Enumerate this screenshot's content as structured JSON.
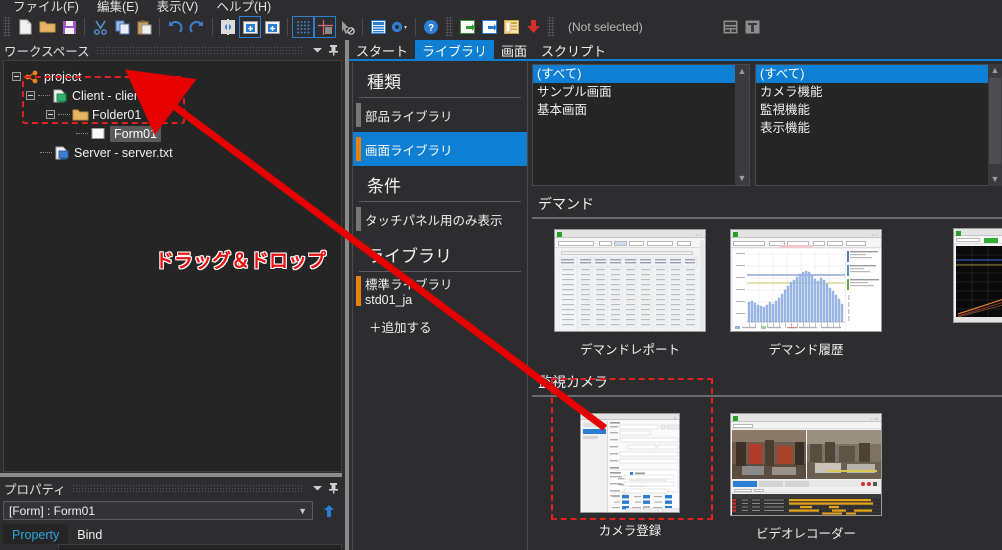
{
  "menu": {
    "items": [
      {
        "label": "ファイル(F)",
        "name": "menu-file"
      },
      {
        "label": "編集(E)",
        "name": "menu-edit"
      },
      {
        "label": "表示(V)",
        "name": "menu-view"
      },
      {
        "label": "ヘルプ(H)",
        "name": "menu-help"
      }
    ]
  },
  "toolbar": {
    "status_text": "(Not selected)",
    "buttons": [
      {
        "name": "new-file-icon",
        "tip": "新規"
      },
      {
        "name": "open-folder-icon",
        "tip": "開く"
      },
      {
        "name": "save-icon",
        "tip": "保存"
      },
      {
        "name": "cut-icon",
        "tip": "切り取り"
      },
      {
        "name": "copy-icon",
        "tip": "コピー"
      },
      {
        "name": "paste-icon",
        "tip": "貼り付け"
      },
      {
        "name": "undo-icon",
        "tip": "元に戻す"
      },
      {
        "name": "redo-icon",
        "tip": "やり直し"
      },
      {
        "name": "settings-gear-icon",
        "tip": "設定"
      },
      {
        "name": "add-window-icon",
        "tip": "追加"
      },
      {
        "name": "add-window-2-icon",
        "tip": "追加2"
      },
      {
        "name": "grid-dots-icon",
        "tip": "グリッド"
      },
      {
        "name": "align-crosshair-icon",
        "tip": "整列"
      },
      {
        "name": "select-disabled-icon",
        "tip": "選択不可"
      },
      {
        "name": "properties-window-icon",
        "tip": "プロパティ"
      },
      {
        "name": "gear-dropdown-icon",
        "tip": "オプション"
      },
      {
        "name": "help-icon",
        "tip": "ヘルプ"
      },
      {
        "name": "run-green-icon",
        "tip": "実行"
      },
      {
        "name": "run-blue-icon",
        "tip": "実行2"
      },
      {
        "name": "table-icon",
        "tip": "テーブル"
      },
      {
        "name": "download-red-icon",
        "tip": "ダウンロード"
      },
      {
        "name": "layout-icon",
        "tip": "レイアウト"
      },
      {
        "name": "text-tool-icon",
        "tip": "テキスト"
      }
    ]
  },
  "workspace": {
    "title": "ワークスペース",
    "tree": [
      {
        "label": "project",
        "icon": "project-icon",
        "depth": 0,
        "expander": "minus"
      },
      {
        "label": "Client - client.xml",
        "icon": "client-file-icon",
        "depth": 1,
        "expander": "minus"
      },
      {
        "label": "Folder01",
        "icon": "folder-icon",
        "depth": 2,
        "expander": "minus"
      },
      {
        "label": "Form01",
        "icon": "form-icon",
        "depth": 3,
        "expander": "none",
        "selected": true
      },
      {
        "label": "Server - server.txt",
        "icon": "server-file-icon",
        "depth": 1,
        "expander": "none"
      }
    ],
    "drag_label": "ドラッグ＆ドロップ"
  },
  "property": {
    "title": "プロパティ",
    "selected_object": "[Form] : Form01",
    "tabs": [
      {
        "label": "Property",
        "active": true
      },
      {
        "label": "Bind",
        "active": false
      }
    ]
  },
  "tabs": [
    {
      "label": "スタート",
      "active": false,
      "name": "tab-start"
    },
    {
      "label": "ライブラリ",
      "active": true,
      "name": "tab-library"
    },
    {
      "label": "画面",
      "active": false,
      "name": "tab-screen"
    },
    {
      "label": "スクリプト",
      "active": false,
      "name": "tab-script"
    }
  ],
  "category_panel": {
    "sections": [
      {
        "heading": "種類",
        "items": [
          {
            "label": "部品ライブラリ",
            "selected": false,
            "accent": "gray"
          },
          {
            "label": "画面ライブラリ",
            "selected": true,
            "accent": "orange"
          }
        ]
      },
      {
        "heading": "条件",
        "items": [
          {
            "label": "タッチパネル用のみ表示",
            "selected": false,
            "accent": "gray"
          }
        ]
      },
      {
        "heading": "ライブラリ",
        "items2": [
          {
            "label1": "標準ライブラリ",
            "label2": "std01_ja",
            "accent": "orange"
          }
        ],
        "add_label": "＋追加する"
      }
    ]
  },
  "filter_lists": [
    {
      "name": "screen-category-list",
      "items": [
        {
          "label": "(すべて)",
          "selected": true
        },
        {
          "label": "サンプル画面",
          "selected": false
        },
        {
          "label": "基本画面",
          "selected": false
        }
      ]
    },
    {
      "name": "function-category-list",
      "items": [
        {
          "label": "(すべて)",
          "selected": true
        },
        {
          "label": "カメラ機能",
          "selected": false
        },
        {
          "label": "監視機能",
          "selected": false
        },
        {
          "label": "表示機能",
          "selected": false
        }
      ]
    }
  ],
  "content": {
    "sections": [
      {
        "title": "デマンド",
        "name": "section-demand",
        "items": [
          {
            "caption": "デマンドレポート",
            "thumb": "table-report",
            "selected": false
          },
          {
            "caption": "デマンド履歴",
            "thumb": "bar-chart",
            "selected": false
          },
          {
            "caption": "",
            "thumb": "line-chart-dark",
            "selected": false,
            "partial": true
          }
        ]
      },
      {
        "title": "監視カメラ",
        "name": "section-camera",
        "items": [
          {
            "caption": "カメラ登録",
            "thumb": "settings-form",
            "selected": true
          },
          {
            "caption": "ビデオレコーダー",
            "thumb": "video-grid",
            "selected": false
          }
        ]
      }
    ]
  },
  "colors": {
    "accent_blue": "#0f7fd4",
    "accent_orange": "#e8820c",
    "highlight_red": "#e02020",
    "panel_bg": "#2d2d30",
    "panel_dark": "#252526"
  }
}
